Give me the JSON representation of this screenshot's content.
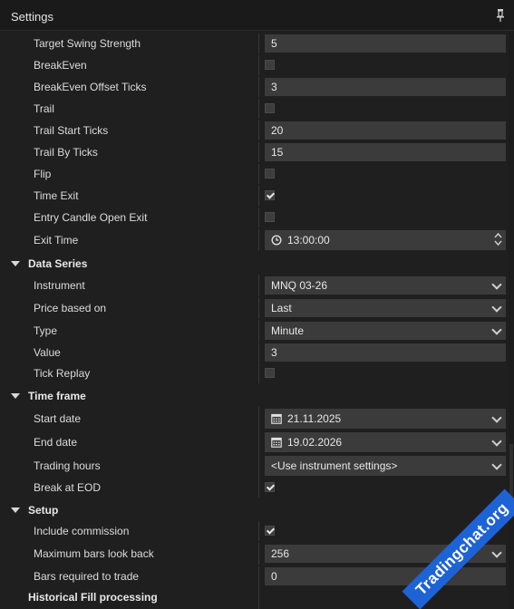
{
  "window": {
    "title": "Settings"
  },
  "properties": {
    "target_swing_strength": {
      "label": "Target Swing Strength",
      "value": "5"
    },
    "breakeven": {
      "label": "BreakEven",
      "checked": false
    },
    "breakeven_offset_ticks": {
      "label": "BreakEven Offset Ticks",
      "value": "3"
    },
    "trail": {
      "label": "Trail",
      "checked": false
    },
    "trail_start_ticks": {
      "label": "Trail Start Ticks",
      "value": "20"
    },
    "trail_by_ticks": {
      "label": "Trail By Ticks",
      "value": "15"
    },
    "flip": {
      "label": "Flip",
      "checked": false
    },
    "time_exit": {
      "label": "Time Exit",
      "checked": true
    },
    "entry_candle_open_exit": {
      "label": "Entry Candle Open Exit",
      "checked": false
    },
    "exit_time": {
      "label": "Exit Time",
      "value": "13:00:00",
      "icon": "clock-icon"
    }
  },
  "data_series": {
    "header": "Data Series",
    "instrument": {
      "label": "Instrument",
      "value": "MNQ 03-26"
    },
    "price_based_on": {
      "label": "Price based on",
      "value": "Last"
    },
    "type": {
      "label": "Type",
      "value": "Minute"
    },
    "value": {
      "label": "Value",
      "value": "3"
    },
    "tick_replay": {
      "label": "Tick Replay",
      "checked": false
    }
  },
  "time_frame": {
    "header": "Time frame",
    "start_date": {
      "label": "Start date",
      "value": "21.11.2025",
      "icon": "calendar-icon"
    },
    "end_date": {
      "label": "End date",
      "value": "19.02.2026",
      "icon": "calendar-icon"
    },
    "trading_hours": {
      "label": "Trading hours",
      "value": "<Use instrument settings>"
    },
    "break_at_eod": {
      "label": "Break at EOD",
      "checked": true
    }
  },
  "setup": {
    "header": "Setup",
    "include_commission": {
      "label": "Include commission",
      "checked": true
    },
    "maximum_bars_look_back": {
      "label": "Maximum bars look back",
      "value": "256"
    },
    "bars_required_to_trade": {
      "label": "Bars required to trade",
      "value": "0"
    }
  },
  "partial_header": "Historical Fill processing",
  "watermark": "Tradingchat.org",
  "colors": {
    "background": "#1f1f1f",
    "field": "#3b3b3b",
    "watermark": "#1e63d6"
  }
}
